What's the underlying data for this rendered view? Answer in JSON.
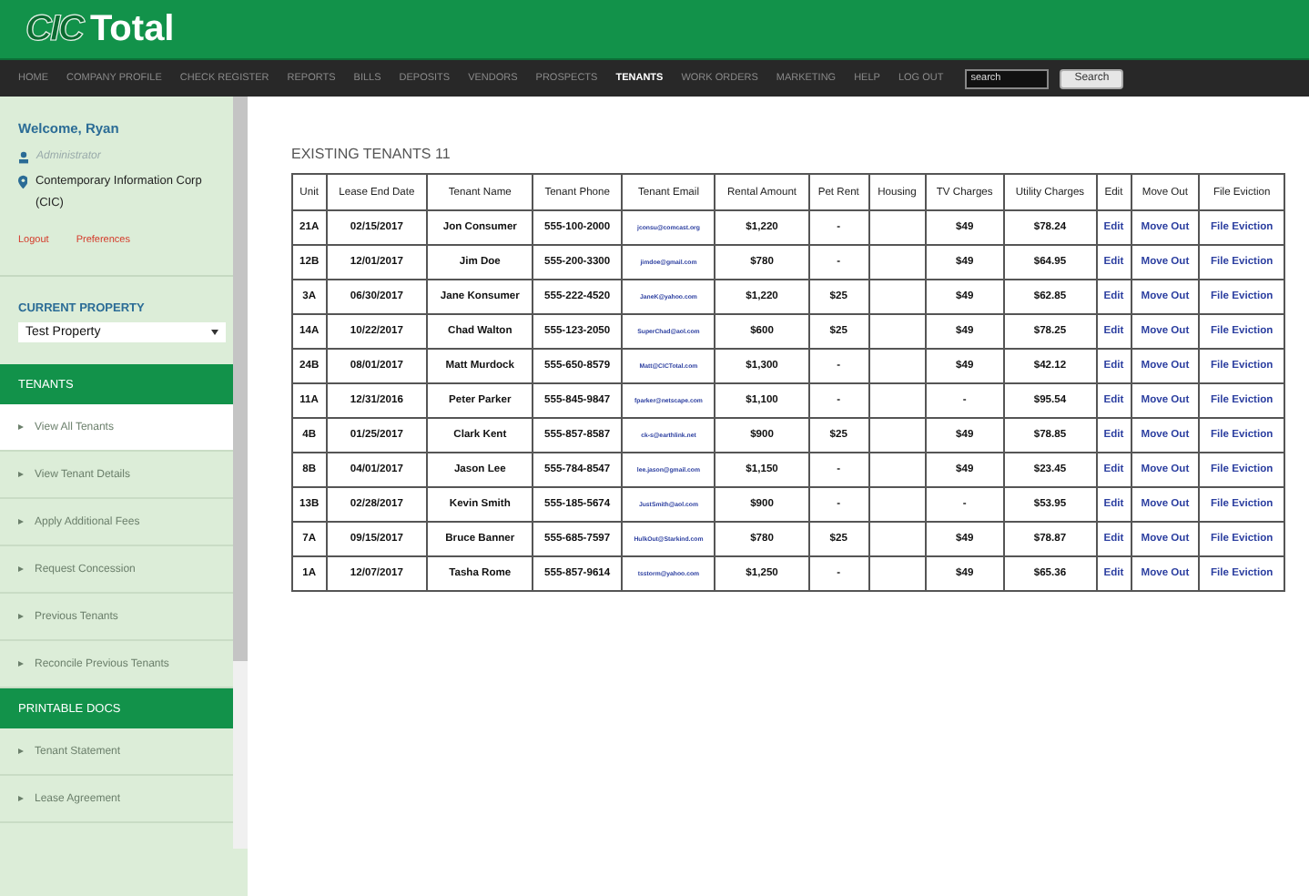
{
  "header": {
    "logo_mark": "CIC",
    "logo_text": "Total"
  },
  "nav": {
    "items": [
      {
        "label": "HOME",
        "selected": false
      },
      {
        "label": "COMPANY PROFILE",
        "selected": false
      },
      {
        "label": "CHECK REGISTER",
        "selected": false
      },
      {
        "label": "REPORTS",
        "selected": false
      },
      {
        "label": "BILLS",
        "selected": false
      },
      {
        "label": "DEPOSITS",
        "selected": false
      },
      {
        "label": "VENDORS",
        "selected": false
      },
      {
        "label": "PROSPECTS",
        "selected": false
      },
      {
        "label": "TENANTS",
        "selected": true
      },
      {
        "label": "WORK ORDERS",
        "selected": false
      },
      {
        "label": "MARKETING",
        "selected": false
      },
      {
        "label": "HELP",
        "selected": false
      },
      {
        "label": "LOG OUT",
        "selected": false
      }
    ],
    "search": {
      "value": "search",
      "button": "Search"
    }
  },
  "sidebar": {
    "welcome": "Welcome, Ryan",
    "role": "Administrator",
    "company": "Contemporary Information Corp (CIC)",
    "links": [
      "Logout",
      "Preferences"
    ],
    "current_property": {
      "label": "CURRENT PROPERTY",
      "value": "Test Property"
    },
    "sections": [
      {
        "heading": "TENANTS",
        "items": [
          {
            "label": "View All Tenants",
            "selected": true
          },
          {
            "label": "View Tenant Details",
            "selected": false
          },
          {
            "label": "Apply Additional Fees",
            "selected": false
          },
          {
            "label": "Request Concession",
            "selected": false
          },
          {
            "label": "Previous Tenants",
            "selected": false
          },
          {
            "label": "Reconcile Previous Tenants",
            "selected": false
          }
        ]
      },
      {
        "heading": "PRINTABLE DOCS",
        "items": [
          {
            "label": "Tenant Statement",
            "selected": false
          },
          {
            "label": "Lease Agreement",
            "selected": false
          }
        ]
      }
    ]
  },
  "main": {
    "title": "EXISTING TENANTS 11",
    "table": {
      "columns": [
        "Unit",
        "Lease End Date",
        "Tenant Name",
        "Tenant Phone",
        "Tenant Email",
        "Rental Amount",
        "Pet Rent",
        "Housing",
        "TV Charges",
        "Utility Charges",
        "Edit",
        "Move Out",
        "File Eviction"
      ],
      "rows": [
        [
          "21A",
          "02/15/2017",
          "Jon Consumer",
          "555-100-2000",
          "jconsu@comcast.org",
          "$1,220",
          "-",
          "",
          "$49",
          "$78.24",
          "Edit",
          "Move Out",
          "File Eviction"
        ],
        [
          "12B",
          "12/01/2017",
          "Jim Doe",
          "555-200-3300",
          "jimdoe@gmail.com",
          "$780",
          "-",
          "",
          "$49",
          "$64.95",
          "Edit",
          "Move Out",
          "File Eviction"
        ],
        [
          "3A",
          "06/30/2017",
          "Jane Konsumer",
          "555-222-4520",
          "JaneK@yahoo.com",
          "$1,220",
          "$25",
          "",
          "$49",
          "$62.85",
          "Edit",
          "Move Out",
          "File Eviction"
        ],
        [
          "14A",
          "10/22/2017",
          "Chad Walton",
          "555-123-2050",
          "SuperChad@aol.com",
          "$600",
          "$25",
          "",
          "$49",
          "$78.25",
          "Edit",
          "Move Out",
          "File Eviction"
        ],
        [
          "24B",
          "08/01/2017",
          "Matt Murdock",
          "555-650-8579",
          "Matt@CICTotal.com",
          "$1,300",
          "-",
          "",
          "$49",
          "$42.12",
          "Edit",
          "Move Out",
          "File Eviction"
        ],
        [
          "11A",
          "12/31/2016",
          "Peter Parker",
          "555-845-9847",
          "fparker@netscape.com",
          "$1,100",
          "-",
          "",
          "-",
          "$95.54",
          "Edit",
          "Move Out",
          "File Eviction"
        ],
        [
          "4B",
          "01/25/2017",
          "Clark Kent",
          "555-857-8587",
          "ck-s@earthlink.net",
          "$900",
          "$25",
          "",
          "$49",
          "$78.85",
          "Edit",
          "Move Out",
          "File Eviction"
        ],
        [
          "8B",
          "04/01/2017",
          "Jason Lee",
          "555-784-8547",
          "lee.jason@gmail.com",
          "$1,150",
          "-",
          "",
          "$49",
          "$23.45",
          "Edit",
          "Move Out",
          "File Eviction"
        ],
        [
          "13B",
          "02/28/2017",
          "Kevin Smith",
          "555-185-5674",
          "JustSmith@aol.com",
          "$900",
          "-",
          "",
          "-",
          "$53.95",
          "Edit",
          "Move Out",
          "File Eviction"
        ],
        [
          "7A",
          "09/15/2017",
          "Bruce Banner",
          "555-685-7597",
          "HulkOut@Starkind.com",
          "$780",
          "$25",
          "",
          "$49",
          "$78.87",
          "Edit",
          "Move Out",
          "File Eviction"
        ],
        [
          "1A",
          "12/07/2017",
          "Tasha Rome",
          "555-857-9614",
          "tsstorm@yahoo.com",
          "$1,250",
          "-",
          "",
          "$49",
          "$65.36",
          "Edit",
          "Move Out",
          "File Eviction"
        ]
      ]
    }
  }
}
